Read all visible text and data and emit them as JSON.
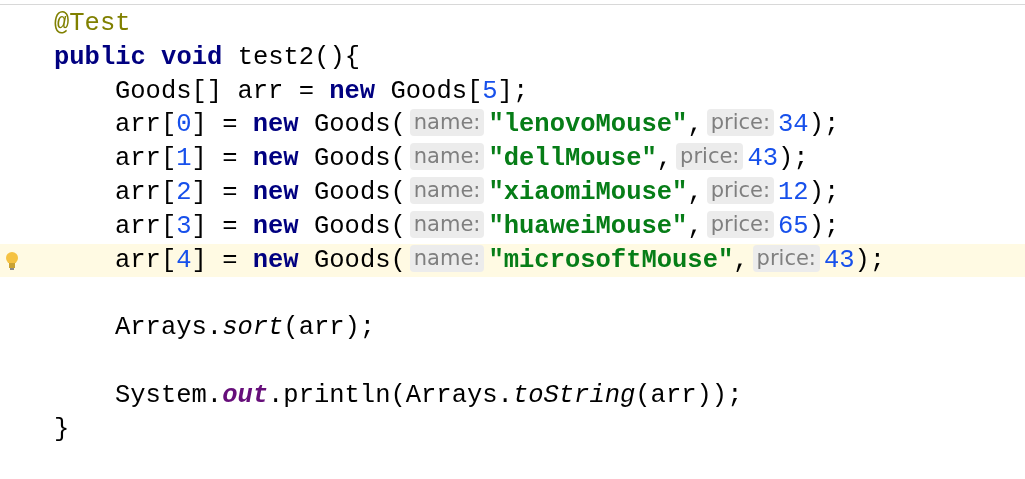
{
  "editor": {
    "annotation": {
      "tokens": [
        {
          "kind": "annotation",
          "text": "@Test"
        }
      ]
    },
    "method": {
      "signature": [
        {
          "kind": "keyword",
          "text": "public void"
        },
        {
          "kind": "plain",
          "text": " test2(){"
        }
      ],
      "body": [
        {
          "kind": "code",
          "current": false,
          "tokens": [
            {
              "kind": "plain",
              "text": "Goods[] arr = "
            },
            {
              "kind": "keyword",
              "text": "new"
            },
            {
              "kind": "plain",
              "text": " Goods["
            },
            {
              "kind": "number",
              "text": "5"
            },
            {
              "kind": "plain",
              "text": "];"
            }
          ]
        },
        {
          "kind": "code",
          "current": false,
          "tokens": [
            {
              "kind": "plain",
              "text": "arr["
            },
            {
              "kind": "number",
              "text": "0"
            },
            {
              "kind": "plain",
              "text": "] = "
            },
            {
              "kind": "keyword",
              "text": "new"
            },
            {
              "kind": "plain",
              "text": " Goods("
            },
            {
              "kind": "hint",
              "text": "name:"
            },
            {
              "kind": "string",
              "text": "\"lenovoMouse\""
            },
            {
              "kind": "plain",
              "text": ","
            },
            {
              "kind": "hint",
              "text": "price:"
            },
            {
              "kind": "number",
              "text": "34"
            },
            {
              "kind": "plain",
              "text": ");"
            }
          ]
        },
        {
          "kind": "code",
          "current": false,
          "tokens": [
            {
              "kind": "plain",
              "text": "arr["
            },
            {
              "kind": "number",
              "text": "1"
            },
            {
              "kind": "plain",
              "text": "] = "
            },
            {
              "kind": "keyword",
              "text": "new"
            },
            {
              "kind": "plain",
              "text": " Goods("
            },
            {
              "kind": "hint",
              "text": "name:"
            },
            {
              "kind": "string",
              "text": "\"dellMouse\""
            },
            {
              "kind": "plain",
              "text": ","
            },
            {
              "kind": "hint",
              "text": "price:"
            },
            {
              "kind": "number",
              "text": "43"
            },
            {
              "kind": "plain",
              "text": ");"
            }
          ]
        },
        {
          "kind": "code",
          "current": false,
          "tokens": [
            {
              "kind": "plain",
              "text": "arr["
            },
            {
              "kind": "number",
              "text": "2"
            },
            {
              "kind": "plain",
              "text": "] = "
            },
            {
              "kind": "keyword",
              "text": "new"
            },
            {
              "kind": "plain",
              "text": " Goods("
            },
            {
              "kind": "hint",
              "text": "name:"
            },
            {
              "kind": "string",
              "text": "\"xiaomiMouse\""
            },
            {
              "kind": "plain",
              "text": ","
            },
            {
              "kind": "hint",
              "text": "price:"
            },
            {
              "kind": "number",
              "text": "12"
            },
            {
              "kind": "plain",
              "text": ");"
            }
          ]
        },
        {
          "kind": "code",
          "current": false,
          "tokens": [
            {
              "kind": "plain",
              "text": "arr["
            },
            {
              "kind": "number",
              "text": "3"
            },
            {
              "kind": "plain",
              "text": "] = "
            },
            {
              "kind": "keyword",
              "text": "new"
            },
            {
              "kind": "plain",
              "text": " Goods("
            },
            {
              "kind": "hint",
              "text": "name:"
            },
            {
              "kind": "string",
              "text": "\"huaweiMouse\""
            },
            {
              "kind": "plain",
              "text": ","
            },
            {
              "kind": "hint",
              "text": "price:"
            },
            {
              "kind": "number",
              "text": "65"
            },
            {
              "kind": "plain",
              "text": ");"
            }
          ]
        },
        {
          "kind": "code",
          "current": true,
          "tokens": [
            {
              "kind": "plain",
              "text": "arr["
            },
            {
              "kind": "number",
              "text": "4"
            },
            {
              "kind": "plain",
              "text": "] = "
            },
            {
              "kind": "keyword",
              "text": "new"
            },
            {
              "kind": "plain",
              "text": " Goods("
            },
            {
              "kind": "hint",
              "text": "name:"
            },
            {
              "kind": "string",
              "text": "\"microsoftMouse\""
            },
            {
              "kind": "plain",
              "text": ","
            },
            {
              "kind": "hint",
              "text": "price:"
            },
            {
              "kind": "number",
              "text": "43"
            },
            {
              "kind": "plain",
              "text": ");"
            }
          ]
        },
        {
          "kind": "blank"
        },
        {
          "kind": "code",
          "current": false,
          "tokens": [
            {
              "kind": "plain",
              "text": "Arrays."
            },
            {
              "kind": "static",
              "text": "sort"
            },
            {
              "kind": "plain",
              "text": "(arr);"
            }
          ]
        },
        {
          "kind": "blank"
        },
        {
          "kind": "code",
          "current": false,
          "tokens": [
            {
              "kind": "plain",
              "text": "System."
            },
            {
              "kind": "field",
              "text": "out"
            },
            {
              "kind": "plain",
              "text": ".println(Arrays."
            },
            {
              "kind": "static",
              "text": "toString"
            },
            {
              "kind": "plain",
              "text": "(arr));"
            }
          ]
        }
      ],
      "closing": [
        {
          "kind": "plain",
          "text": "}"
        }
      ]
    }
  }
}
